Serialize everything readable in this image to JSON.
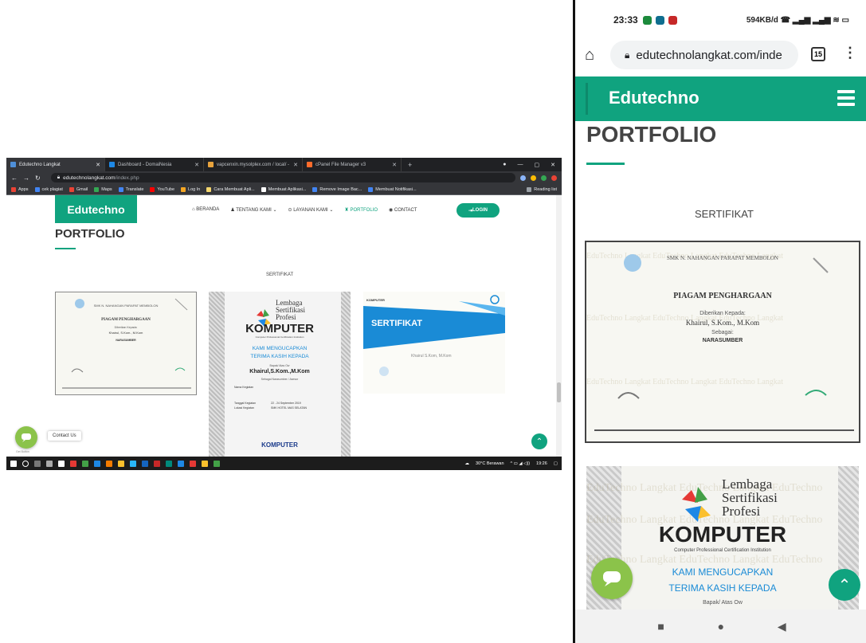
{
  "desktop": {
    "tabs": [
      {
        "label": "Edutechno Langkat",
        "color": "#4f8fd8"
      },
      {
        "label": "Dashboard - DomaiNesia",
        "color": "#1e88e5"
      },
      {
        "label": "vapcenxin.mysolplex.com / local/ -",
        "color": "#e8a33d"
      },
      {
        "label": "cPanel File Manager v3",
        "color": "#ff6c2c"
      }
    ],
    "url_host": "edutechnolangkat.com",
    "url_path": "/index.php",
    "bookmarks": [
      "Apps",
      "cek plagiat",
      "Gmail",
      "Maps",
      "Translate",
      "YouTube",
      "Log In",
      "Cara Membuat Apli...",
      "Membuat Aplikasi...",
      "Remove Image Bac...",
      "Membuat Notifikasi..."
    ],
    "reading_list": "Reading list",
    "site": {
      "brand": "Edutechno",
      "menu": [
        "BERANDA",
        "TENTANG KAMI",
        "LAYANAN KAMI",
        "PORTFOLIO",
        "CONTACT"
      ],
      "login": "LOGIN",
      "title": "PORTFOLIO",
      "section": "SERTIFIKAT",
      "contact_us": "Contact Us",
      "chat_label": "Get Button"
    },
    "taskbar": {
      "weather": "30°C Berawan",
      "time": "19:26"
    }
  },
  "certificates": {
    "piagam": {
      "heading": "PIAGAM PENGHARGAAN",
      "school": "SMK N. NAHANGAN PARAPAT MEMBOLON",
      "award_to": "Diberikan Kepada:",
      "name": "Khairul, S.Kom., M.Kom",
      "role_label": "Sebagai:",
      "role": "NARASUMBER"
    },
    "lsp": {
      "org_line1": "Lembaga",
      "org_line2": "Sertifikasi",
      "org_line3": "Profesi",
      "main": "KOMPUTER",
      "sub": "Computer Professional Certification Institution",
      "thanks1": "KAMI MENGUCAPKAN",
      "thanks2": "TERIMA KASIH KEPADA",
      "honorific": "Bapak/ Atas Ow",
      "name": "Khairul,S.Kom.,M.Kom",
      "role": "Sebagai Narasumber / Asesor",
      "field1_label": "Nama Kegiatan",
      "field2_label": "Tanggal Kegiatan",
      "field3_label": "Lokasi Kegiatan",
      "date": "22 - 24 September 2019",
      "place": "SMK HOTEL MAS SELATAN"
    },
    "sertifikat": {
      "label": "SERTIFIKAT",
      "brand": "KOMPUTER",
      "name": "Khairul S.Kom, M.Kom"
    }
  },
  "phone": {
    "status_time": "23:33",
    "status_right": "594KB/d",
    "url": "edutechnolangkat.com/inde",
    "tab_count": "15",
    "brand": "Edutechno",
    "title": "PORTFOLIO",
    "section": "SERTIFIKAT"
  },
  "colors": {
    "brand": "#10a37f",
    "chat": "#8bc34a",
    "cert_blue": "#1a8bd6"
  }
}
